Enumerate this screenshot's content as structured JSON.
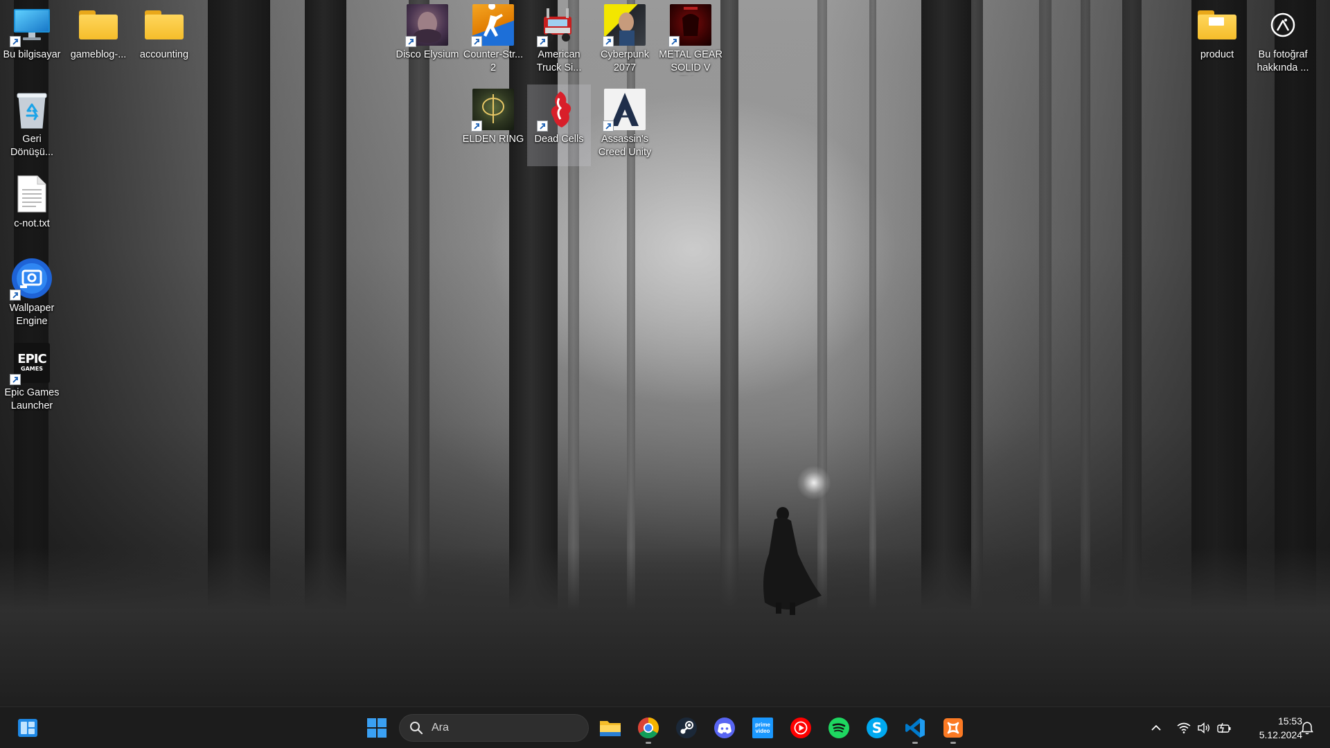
{
  "desktop": {
    "icons": [
      {
        "label": "Bu bilgisayar",
        "icon": "computer-icon"
      },
      {
        "label": "gameblog-...",
        "icon": "folder-icon"
      },
      {
        "label": "accounting",
        "icon": "folder-icon"
      },
      {
        "label": "Geri Dönüşü...",
        "icon": "recycle-bin-icon"
      },
      {
        "label": "c-not.txt",
        "icon": "text-file-icon"
      },
      {
        "label": "Wallpaper Engine",
        "icon": "wallpaper-engine-icon"
      },
      {
        "label": "Epic Games Launcher",
        "icon": "epic-games-icon",
        "logo_text": "EPIC",
        "logo_sub": "GAMES"
      },
      {
        "label": "Disco Elysium",
        "icon": "disco-elysium-icon"
      },
      {
        "label": "Counter-Str... 2",
        "icon": "counter-strike-icon"
      },
      {
        "label": "American Truck Si...",
        "icon": "american-truck-simulator-icon"
      },
      {
        "label": "Cyberpunk 2077",
        "icon": "cyberpunk-icon"
      },
      {
        "label": "METAL GEAR SOLID V TH...",
        "icon": "metal-gear-icon"
      },
      {
        "label": "ELDEN RING",
        "icon": "elden-ring-icon"
      },
      {
        "label": "Dead Cells",
        "icon": "dead-cells-icon"
      },
      {
        "label": "Assassin's Creed Unity",
        "icon": "assassins-creed-icon"
      },
      {
        "label": "product",
        "icon": "folder-icon"
      },
      {
        "label": "Bu fotoğraf hakkında ...",
        "icon": "camera-info-icon"
      }
    ]
  },
  "taskbar": {
    "search_placeholder": "Ara",
    "apps": [
      {
        "name": "file-explorer",
        "icon": "folder-icon"
      },
      {
        "name": "chrome",
        "icon": "chrome-icon",
        "running": true
      },
      {
        "name": "steam",
        "icon": "steam-icon"
      },
      {
        "name": "discord",
        "icon": "discord-icon"
      },
      {
        "name": "prime-video",
        "icon": "prime-video-icon",
        "text": "prime video"
      },
      {
        "name": "youtube-music",
        "icon": "youtube-music-icon"
      },
      {
        "name": "spotify",
        "icon": "spotify-icon"
      },
      {
        "name": "skype",
        "icon": "skype-icon",
        "text": "S"
      },
      {
        "name": "vscode",
        "icon": "vscode-icon",
        "running": true
      },
      {
        "name": "xampp",
        "icon": "xampp-icon",
        "running": true
      }
    ],
    "tray": {
      "time": "15:53",
      "date": "5.12.2024"
    }
  },
  "colors": {
    "taskbar_bg": "#1c1c1c",
    "folder_yellow": "#f5bd2a",
    "windows_blue": "#3aa0f3"
  }
}
